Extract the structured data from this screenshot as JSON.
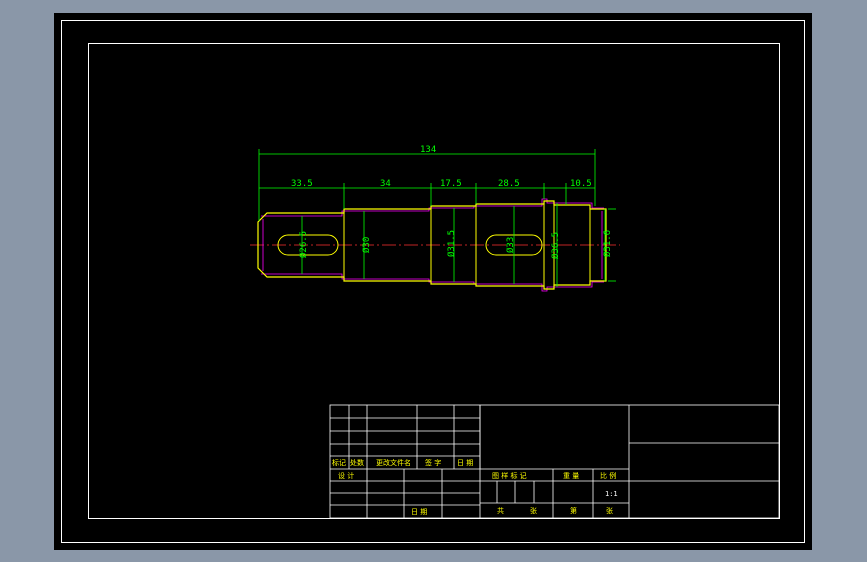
{
  "drawing": {
    "dimensions": {
      "overall": "134",
      "seg1": "33.5",
      "seg2": "34",
      "seg3": "17.5",
      "seg4": "28.5",
      "seg5": "10.5"
    },
    "diameters": {
      "d1": "Ø26.5",
      "d2": "Ø30",
      "d3": "Ø31.5",
      "d4": "Ø33",
      "d5": "Ø36.5",
      "d6": "Ø31.6"
    }
  },
  "title_block": {
    "rev_headers": [
      "标记",
      "处数",
      "更改文件名",
      "签 字",
      "日 期"
    ],
    "design_label": "设 计",
    "date_label": "日 期",
    "stage_label": "图 样 标 记",
    "weight_label": "重 量",
    "scale_label": "比 例",
    "scale_value": "1:1",
    "total_label": "共",
    "sheet_unit_1": "张",
    "sheet_label": "第",
    "sheet_unit_2": "张"
  },
  "colors": {
    "background": "#000000",
    "frame": "#ffffff",
    "dimension": "#00ff00",
    "outline": "#ffff00",
    "centerline": "#ff0000",
    "hatch": "#ff00ff",
    "chrome": "#8a97a8"
  }
}
